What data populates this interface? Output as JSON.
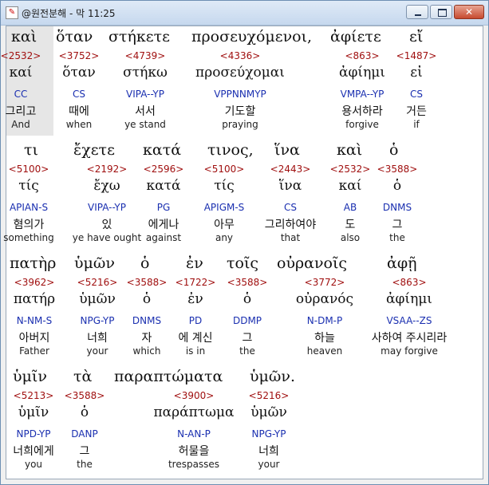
{
  "window": {
    "title": "@원전분해 - 막 11:25",
    "icon_name": "app-icon",
    "close_label": "✕"
  },
  "lines": [
    {
      "greek": [
        {
          "text": "καὶ"
        },
        {
          "text": "ὅταν"
        },
        {
          "text": "στήκετε"
        },
        {
          "text": "προσευχόμενοι,"
        },
        {
          "text": "ἀφίετε"
        },
        {
          "text": "εἴ"
        }
      ],
      "words": [
        {
          "strong": "<2532>",
          "lemma": "καί",
          "parse": "CC",
          "kor": "그리고",
          "eng": "And"
        },
        {
          "strong": "<3752>",
          "lemma": "ὅταν",
          "parse": "CS",
          "kor": "때에",
          "eng": "when"
        },
        {
          "strong": "<4739>",
          "lemma": "στήκω",
          "parse": "VIPA--YP",
          "kor": "서서",
          "eng": "ye stand"
        },
        {
          "strong": "<4336>",
          "lemma": "προσεύχομαι",
          "parse": "VPPNNMYP",
          "kor": "기도할",
          "eng": "praying"
        },
        {
          "strong": "<863>",
          "lemma": "ἀφίημι",
          "parse": "VMPA--YP",
          "kor": "용서하라",
          "eng": "forgive"
        },
        {
          "strong": "<1487>",
          "lemma": "εἰ",
          "parse": "CS",
          "kor": "거든",
          "eng": "if"
        }
      ]
    },
    {
      "greek": [
        {
          "text": "τι"
        },
        {
          "text": "ἔχετε"
        },
        {
          "text": "κατά"
        },
        {
          "text": "τινος,"
        },
        {
          "text": "ἵνα"
        },
        {
          "text": "καὶ"
        },
        {
          "text": "ὁ"
        }
      ],
      "words": [
        {
          "strong": "<5100>",
          "lemma": "τίς",
          "parse": "APIAN-S",
          "kor": "혐의가",
          "eng": "something"
        },
        {
          "strong": "<2192>",
          "lemma": "ἔχω",
          "parse": "VIPA--YP",
          "kor": "있",
          "eng": "ye have ought"
        },
        {
          "strong": "<2596>",
          "lemma": "κατά",
          "parse": "PG",
          "kor": "에게나",
          "eng": "against"
        },
        {
          "strong": "<5100>",
          "lemma": "τίς",
          "parse": "APIGM-S",
          "kor": "아무",
          "eng": "any"
        },
        {
          "strong": "<2443>",
          "lemma": "ἵνα",
          "parse": "CS",
          "kor": "그리하여야",
          "eng": "that"
        },
        {
          "strong": "<2532>",
          "lemma": "καί",
          "parse": "AB",
          "kor": "도",
          "eng": "also"
        },
        {
          "strong": "<3588>",
          "lemma": "ὁ",
          "parse": "DNMS",
          "kor": "그",
          "eng": "the"
        }
      ]
    },
    {
      "greek": [
        {
          "text": "πατὴρ"
        },
        {
          "text": "ὑμῶν"
        },
        {
          "text": "ὁ"
        },
        {
          "text": "ἐν"
        },
        {
          "text": "τοῖς"
        },
        {
          "text": "οὐρανοῖς"
        },
        {
          "text": "ἀφῇ"
        }
      ],
      "words": [
        {
          "strong": "<3962>",
          "lemma": "πατήρ",
          "parse": "N-NM-S",
          "kor": "아버지",
          "eng": "Father"
        },
        {
          "strong": "<5216>",
          "lemma": "ὑμῶν",
          "parse": "NPG-YP",
          "kor": "너희",
          "eng": "your"
        },
        {
          "strong": "<3588>",
          "lemma": "ὁ",
          "parse": "DNMS",
          "kor": "자",
          "eng": "which"
        },
        {
          "strong": "<1722>",
          "lemma": "ἐν",
          "parse": "PD",
          "kor": "에 계신",
          "eng": "is in"
        },
        {
          "strong": "<3588>",
          "lemma": "ὁ",
          "parse": "DDMP",
          "kor": "그",
          "eng": "the"
        },
        {
          "strong": "<3772>",
          "lemma": "οὐρανός",
          "parse": "N-DM-P",
          "kor": "하늘",
          "eng": "heaven"
        },
        {
          "strong": "<863>",
          "lemma": "ἀφίημι",
          "parse": "VSAA--ZS",
          "kor": "사하여 주시리라",
          "eng": "may forgive"
        }
      ]
    },
    {
      "greek": [
        {
          "text": "ὑμῖν"
        },
        {
          "text": "τὰ"
        },
        {
          "text": "παραπτώματα"
        },
        {
          "text": "ὑμῶν."
        }
      ],
      "words": [
        {
          "strong": "<5213>",
          "lemma": "ὑμῖν",
          "parse": "NPD-YP",
          "kor": "너희에게",
          "eng": "you"
        },
        {
          "strong": "<3588>",
          "lemma": "ὁ",
          "parse": "DANP",
          "kor": "그",
          "eng": "the"
        },
        {
          "strong": "<3900>",
          "lemma": "παράπτωμα",
          "parse": "N-AN-P",
          "kor": "허물을",
          "eng": "trespasses"
        },
        {
          "strong": "<5216>",
          "lemma": "ὑμῶν",
          "parse": "NPG-YP",
          "kor": "너희",
          "eng": "your"
        }
      ]
    }
  ]
}
